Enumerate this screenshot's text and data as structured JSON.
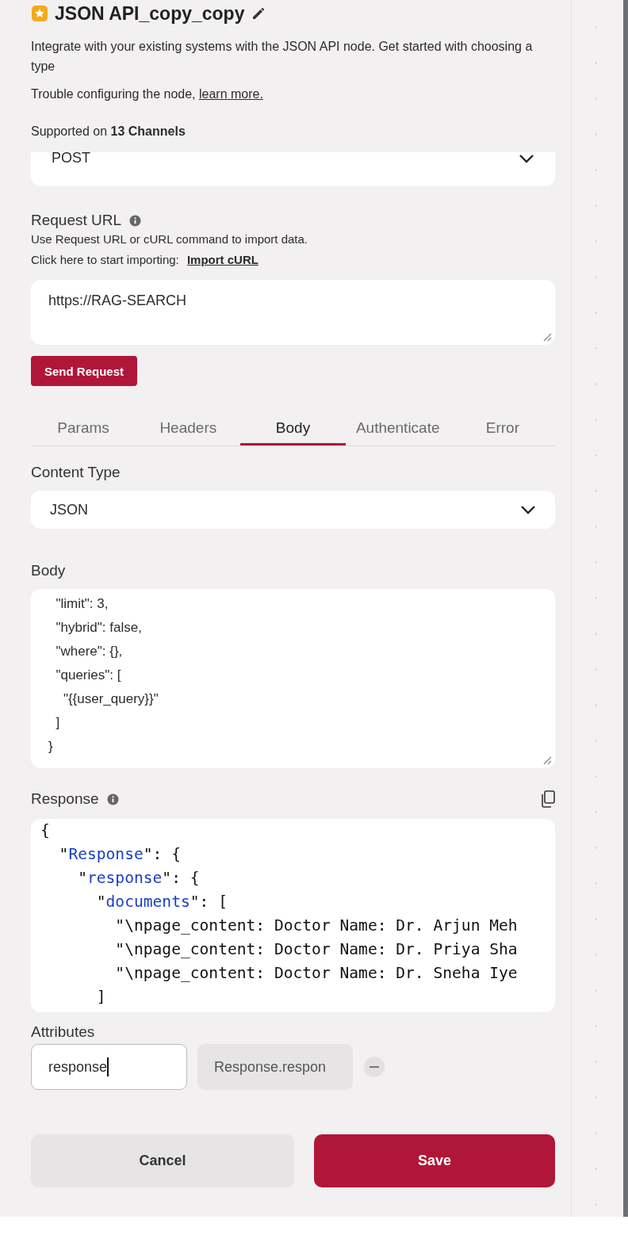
{
  "header": {
    "title": "JSON API_copy_copy",
    "description": "Integrate with your existing systems with the JSON API node. Get started with choosing a type",
    "trouble_text": "Trouble configuring the node,",
    "trouble_link": "learn more.",
    "supported": "Supported on **13 Channels**"
  },
  "method": {
    "value": "POST"
  },
  "request_url": {
    "label": "Request URL",
    "help": "Use Request URL or cURL command to import data.",
    "import_prompt": "Click here to start importing:",
    "import_link": "Import cURL",
    "value": "https://RAG-SEARCH",
    "send_button": "Send Request"
  },
  "tabs": [
    {
      "label": "Params",
      "selected": false
    },
    {
      "label": "Headers",
      "selected": false
    },
    {
      "label": "Body",
      "selected": true
    },
    {
      "label": "Authenticate",
      "selected": false
    },
    {
      "label": "Error",
      "selected": false
    }
  ],
  "content_type": {
    "label": "Content Type",
    "value": "JSON"
  },
  "body": {
    "label": "Body",
    "value": "  \"limit\": 3,\n  \"hybrid\": false,\n  \"where\": {},\n  \"queries\": [\n    \"{{user_query}}\"\n  ]\n}"
  },
  "response": {
    "label": "Response",
    "lines": [
      {
        "pre": "{"
      },
      {
        "pre": "  \"",
        "key": "Response",
        "post": "\": {"
      },
      {
        "pre": "    \"",
        "key": "response",
        "post": "\": {"
      },
      {
        "pre": "      \"",
        "key": "documents",
        "post": "\": ["
      },
      {
        "pre": "        \"\\npage_content: Doctor Name: Dr. Arjun Meh"
      },
      {
        "pre": "        \"\\npage_content: Doctor Name: Dr. Priya Sha"
      },
      {
        "pre": "        \"\\npage_content: Doctor Name: Dr. Sneha Iye"
      },
      {
        "pre": "      ]"
      }
    ]
  },
  "attributes": {
    "label": "Attributes",
    "items": [
      {
        "name": "response",
        "path": "Response.respon"
      }
    ]
  },
  "buttons": {
    "cancel": "Cancel",
    "save": "Save"
  }
}
